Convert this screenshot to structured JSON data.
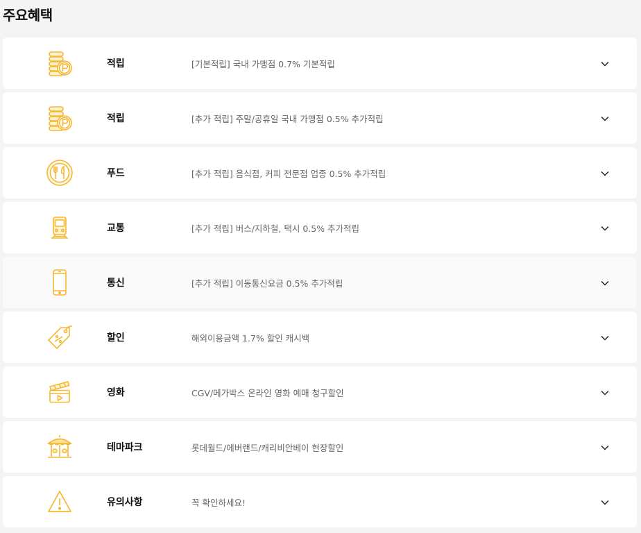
{
  "page_title": "주요혜택",
  "benefits": [
    {
      "category": "적립",
      "description": "[기본적립] 국내 가맹점 0.7% 기본적립",
      "icon": "point-coins-icon"
    },
    {
      "category": "적립",
      "description": "[추가 적립] 주말/공휴일 국내 가맹점 0.5% 추가적립",
      "icon": "point-coins-icon"
    },
    {
      "category": "푸드",
      "description": "[추가 적립] 음식점, 커피 전문점 업종 0.5% 추가적립",
      "icon": "food-plate-icon"
    },
    {
      "category": "교통",
      "description": "[추가 적립] 버스/지하철, 택시 0.5% 추가적립",
      "icon": "train-icon"
    },
    {
      "category": "통신",
      "description": "[추가 적립] 이동통신요금 0.5% 추가적립",
      "icon": "smartphone-icon"
    },
    {
      "category": "할인",
      "description": "해외이용금액 1.7% 할인 캐시백",
      "icon": "discount-tag-icon"
    },
    {
      "category": "영화",
      "description": "CGV/메가박스 온라인 영화 예매 청구할인",
      "icon": "movie-clapper-icon"
    },
    {
      "category": "테마파크",
      "description": "롯데월드/에버랜드/캐리비안베이 현장할인",
      "icon": "carousel-icon"
    },
    {
      "category": "유의사항",
      "description": "꼭 확인하세요!",
      "icon": "warning-icon"
    }
  ],
  "colors": {
    "accent": "#f5b731",
    "accent_light": "#ffe29a",
    "text": "#111111",
    "muted": "#666666"
  }
}
